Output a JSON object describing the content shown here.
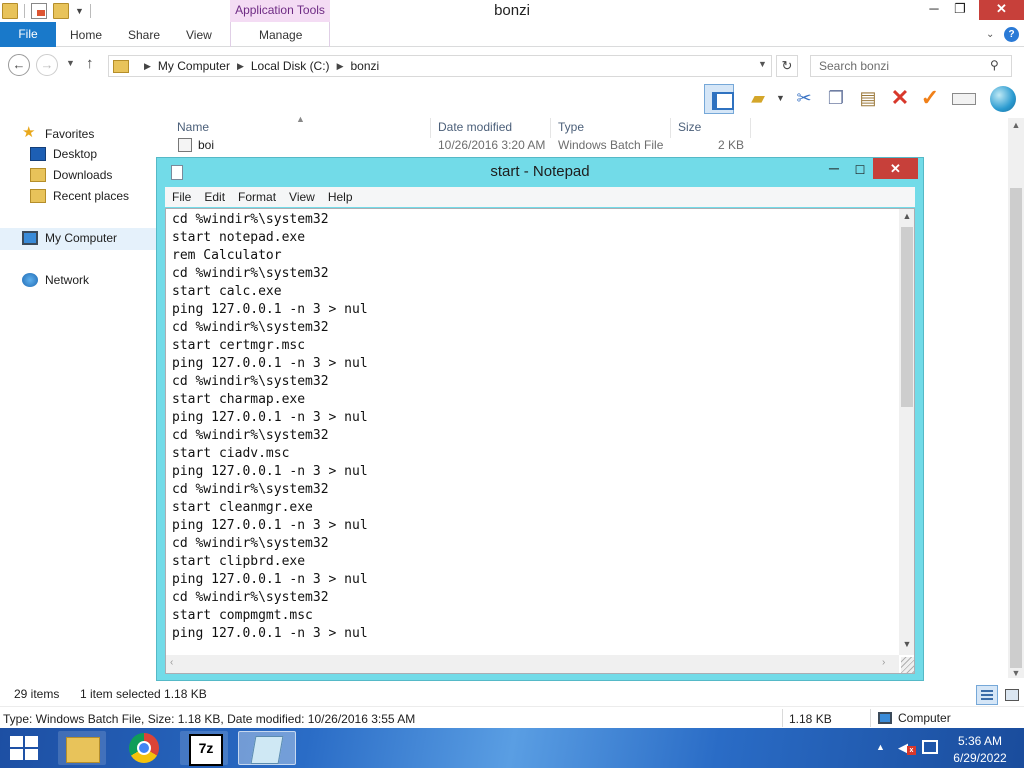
{
  "explorer": {
    "title": "bonzi",
    "context_tab_group": "Application Tools",
    "window_controls": {
      "minimize": "─",
      "maximize": "❐",
      "close": "✕"
    },
    "ribbon_tabs": {
      "file": "File",
      "home": "Home",
      "share": "Share",
      "view": "View",
      "manage": "Manage"
    },
    "address": {
      "crumbs": [
        "My Computer",
        "Local Disk (C:)",
        "bonzi"
      ]
    },
    "search": {
      "placeholder": "Search bonzi"
    },
    "nav_pane": {
      "favorites": "Favorites",
      "desktop": "Desktop",
      "downloads": "Downloads",
      "recent_places": "Recent places",
      "my_computer": "My Computer",
      "network": "Network"
    },
    "columns": {
      "name": "Name",
      "date": "Date modified",
      "type": "Type",
      "size": "Size"
    },
    "files": [
      {
        "name": "boi",
        "date": "10/26/2016 3:20 AM",
        "type": "Windows Batch File",
        "size": "2 KB"
      }
    ],
    "status": {
      "items": "29 items",
      "selected": "1 item selected  1.18 KB"
    },
    "details": {
      "text": "Type: Windows Batch File, Size: 1.18 KB, Date modified: 10/26/2016 3:55 AM",
      "size": "1.18 KB",
      "location": "Computer"
    }
  },
  "notepad": {
    "title": "start - Notepad",
    "menus": [
      "File",
      "Edit",
      "Format",
      "View",
      "Help"
    ],
    "lines": [
      "cd %windir%\\system32",
      "start notepad.exe",
      "rem Calculator",
      "cd %windir%\\system32",
      "start calc.exe",
      "ping 127.0.0.1 -n 3 > nul",
      "cd %windir%\\system32",
      "start certmgr.msc",
      "ping 127.0.0.1 -n 3 > nul",
      "cd %windir%\\system32",
      "start charmap.exe",
      "ping 127.0.0.1 -n 3 > nul",
      "cd %windir%\\system32",
      "start ciadv.msc",
      "ping 127.0.0.1 -n 3 > nul",
      "cd %windir%\\system32",
      "start cleanmgr.exe",
      "ping 127.0.0.1 -n 3 > nul",
      "cd %windir%\\system32",
      "start clipbrd.exe",
      "ping 127.0.0.1 -n 3 > nul",
      "cd %windir%\\system32",
      "start compmgmt.msc",
      "ping 127.0.0.1 -n 3 > nul"
    ]
  },
  "taskbar": {
    "apps": [
      "file-explorer",
      "chrome",
      "7-zip",
      "notepad"
    ],
    "time": "5:36 AM",
    "date": "6/29/2022"
  }
}
